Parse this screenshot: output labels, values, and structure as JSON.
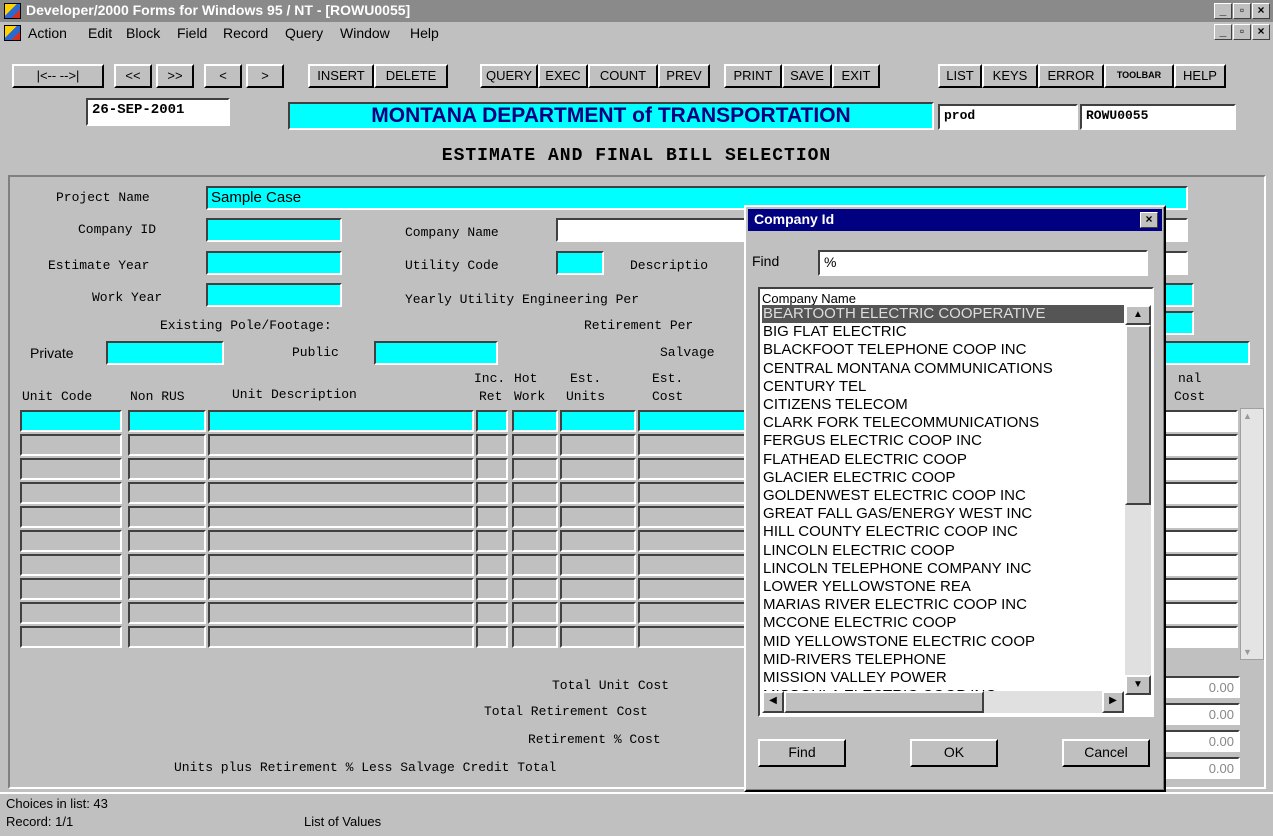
{
  "window": {
    "title": "Developer/2000 Forms for Windows 95 / NT  - [ROWU0055]",
    "min": "_",
    "max": "▫",
    "close": "×"
  },
  "menu": [
    "Action",
    "Edit",
    "Block",
    "Field",
    "Record",
    "Query",
    "Window",
    "Help"
  ],
  "toolbar": {
    "buttons": [
      "|<-- -->|",
      "<<",
      ">>",
      "<",
      ">",
      "INSERT",
      "DELETE",
      "QUERY",
      "EXEC",
      "COUNT",
      "PREV",
      "PRINT",
      "SAVE",
      "EXIT",
      "LIST",
      "KEYS",
      "ERROR",
      "TOOLBAR",
      "HELP"
    ]
  },
  "header": {
    "date": "26-SEP-2001",
    "banner": "MONTANA DEPARTMENT of TRANSPORTATION",
    "env": "prod",
    "form_id": "ROWU0055",
    "heading": "ESTIMATE AND FINAL BILL SELECTION"
  },
  "form": {
    "project_name_label": "Project Name",
    "project_name_value": "Sample Case",
    "company_id_label": "Company ID",
    "company_name_label": "Company Name",
    "estimate_year_label": "Estimate Year",
    "utility_code_label": "Utility Code",
    "description_label": "Descriptio",
    "work_year_label": "Work Year",
    "yearly_eng_label": "Yearly Utility Engineering Per",
    "existing_pole_label": "Existing Pole/Footage:",
    "retirement_label": "Retirement Per",
    "private_label": "Private",
    "public_label": "Public",
    "salvage_label": "Salvage",
    "col_unit_code": "Unit Code",
    "col_non_rus": "Non RUS",
    "col_unit_desc": "Unit Description",
    "col_inc_ret_1": "Inc.",
    "col_inc_ret_2": "Ret",
    "col_hot_work_1": "Hot",
    "col_hot_work_2": "Work",
    "col_est_units_1": "Est.",
    "col_est_units_2": "Units",
    "col_est_cost_1": "Est.",
    "col_est_cost_2": "Cost",
    "col_final_1": "nal",
    "col_final_2": "Cost",
    "total_unit_cost_label": "Total Unit Cost",
    "total_retirement_label": "Total Retirement Cost",
    "retirement_pct_label": "Retirement % Cost",
    "grand_total_label": "Units plus Retirement % Less Salvage Credit Total",
    "totals": [
      "0.00",
      "0.00",
      "0.00",
      "0.00"
    ]
  },
  "dialog": {
    "title": "Company Id",
    "find_label": "Find",
    "find_value": "%",
    "list_header": "Company Name",
    "items": [
      "BEARTOOTH ELECTRIC COOPERATIVE",
      "BIG FLAT ELECTRIC",
      "BLACKFOOT TELEPHONE COOP INC",
      "CENTRAL MONTANA COMMUNICATIONS",
      "CENTURY TEL",
      "CITIZENS TELECOM",
      "CLARK FORK TELECOMMUNICATIONS",
      "FERGUS ELECTRIC COOP INC",
      "FLATHEAD ELECTRIC COOP",
      "GLACIER ELECTRIC COOP",
      "GOLDENWEST ELECTRIC COOP INC",
      "GREAT FALL GAS/ENERGY WEST INC",
      "HILL COUNTY ELECTRIC COOP INC",
      "LINCOLN ELECTRIC COOP",
      "LINCOLN TELEPHONE COMPANY INC",
      "LOWER YELLOWSTONE REA",
      "MARIAS RIVER ELECTRIC COOP INC",
      "MCCONE ELECTRIC COOP",
      "MID YELLOWSTONE ELECTRIC COOP",
      "MID-RIVERS TELEPHONE",
      "MISSION VALLEY POWER",
      "MISSOULA ELECTRIC COOP INC"
    ],
    "find_button": "Find",
    "ok_button": "OK",
    "cancel_button": "Cancel"
  },
  "status": {
    "choices": "Choices in list: 43",
    "record": "Record: 1/1",
    "mode": "List of Values"
  }
}
